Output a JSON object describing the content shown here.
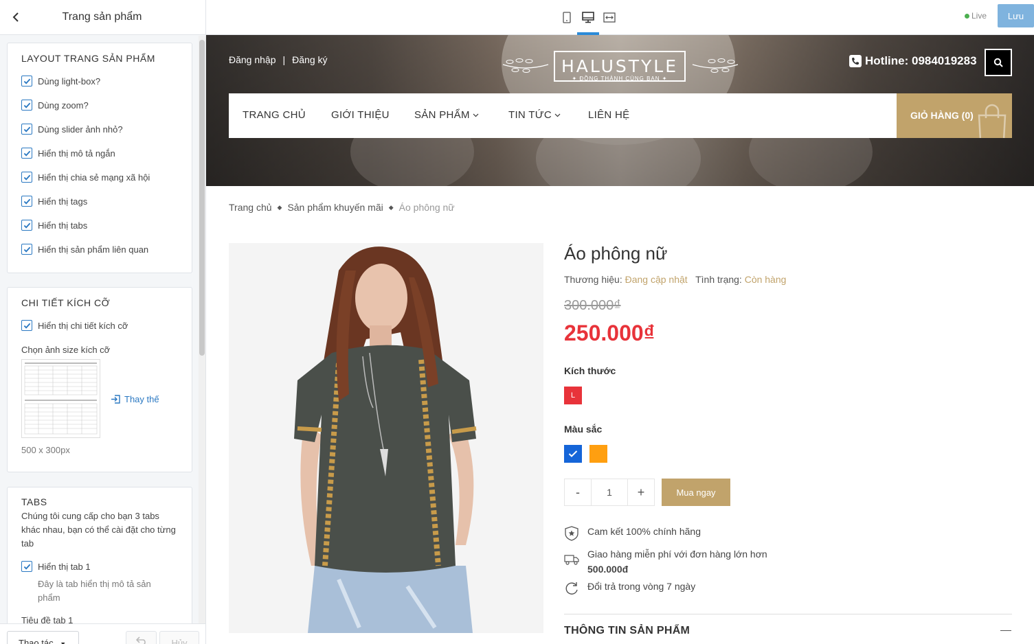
{
  "panel": {
    "title": "Trang sản phẩm",
    "layout_section": {
      "title": "LAYOUT TRANG SẢN PHẨM",
      "options": [
        {
          "label": "Dùng light-box?",
          "checked": true
        },
        {
          "label": "Dùng zoom?",
          "checked": true
        },
        {
          "label": "Dùng slider ảnh nhỏ?",
          "checked": true
        },
        {
          "label": "Hiển thị mô tả ngắn",
          "checked": true
        },
        {
          "label": "Hiển thị chia sẻ mạng xã hội",
          "checked": true
        },
        {
          "label": "Hiển thị tags",
          "checked": true
        },
        {
          "label": "Hiển thị tabs",
          "checked": true
        },
        {
          "label": "Hiển thị sản phẩm liên quan",
          "checked": true
        }
      ]
    },
    "size_section": {
      "title": "CHI TIẾT KÍCH CỠ",
      "show_label": "Hiển thị chi tiết kích cỡ",
      "choose_label": "Chọn ảnh size kích cỡ",
      "replace_label": "Thay thế",
      "dimension": "500 x 300px"
    },
    "tabs_section": {
      "title": "TABS",
      "description": "Chúng tôi cung cấp cho bạn 3 tabs khác nhau, bạn có thể cài đặt cho từng tab",
      "tab1_label": "Hiển thị tab 1",
      "tab1_hint": "Đây là tab hiển thị mô tả sản phẩm",
      "tab1_title_label": "Tiêu đề tab 1"
    },
    "footer": {
      "action_label": "Thao tác",
      "cancel_label": "Hủy"
    }
  },
  "topbar": {
    "live_label": "Live",
    "save_label": "Lưu",
    "devices": [
      "mobile-icon",
      "desktop-icon",
      "fullwidth-icon"
    ],
    "active_device": "desktop"
  },
  "store": {
    "login": "Đăng nhập",
    "separator": "|",
    "register": "Đăng ký",
    "logo_title": "HALUSTYLE",
    "logo_subtitle": "✦ ĐỒNG THÀNH CÙNG BẠN ✦",
    "hotline": "Hotline: 0984019283",
    "nav": [
      "TRANG CHỦ",
      "GIỚI THIỆU",
      "SẢN PHẨM",
      "TIN TỨC",
      "LIÊN HỆ"
    ],
    "cart": "GIỎ HÀNG (0)"
  },
  "breadcrumb": [
    "Trang chủ",
    "Sản phẩm khuyến mãi",
    "Áo phông nữ"
  ],
  "product": {
    "title": "Áo phông nữ",
    "brand_label": "Thương hiệu:",
    "brand_value": "Đang cập nhật",
    "status_label": "Tình trạng:",
    "status_value": "Còn hàng",
    "old_price": "300.000₫",
    "new_price": "250.000₫",
    "size_label": "Kích thước",
    "sizes": [
      "L"
    ],
    "color_label": "Màu sắc",
    "colors": [
      "#1565d8",
      "#ff9f10"
    ],
    "qty_minus": "-",
    "qty": "1",
    "qty_plus": "+",
    "buy_label": "Mua ngay",
    "features": [
      {
        "icon": "shield-star-icon",
        "text": "Cam kết 100% chính hãng"
      },
      {
        "icon": "truck-icon",
        "text": "Giao hàng miễn phí với đơn hàng lớn hơn",
        "bold": "500.000đ"
      },
      {
        "icon": "refresh-icon",
        "text": "Đổi trả trong vòng 7 ngày"
      }
    ],
    "info_title": "THÔNG TIN SẢN PHẨM"
  },
  "colors": {
    "accent_gold": "#c1a36b",
    "price_red": "#e8333a",
    "checkbox_blue": "#2a78c2",
    "save_blue": "#7fb3de"
  }
}
